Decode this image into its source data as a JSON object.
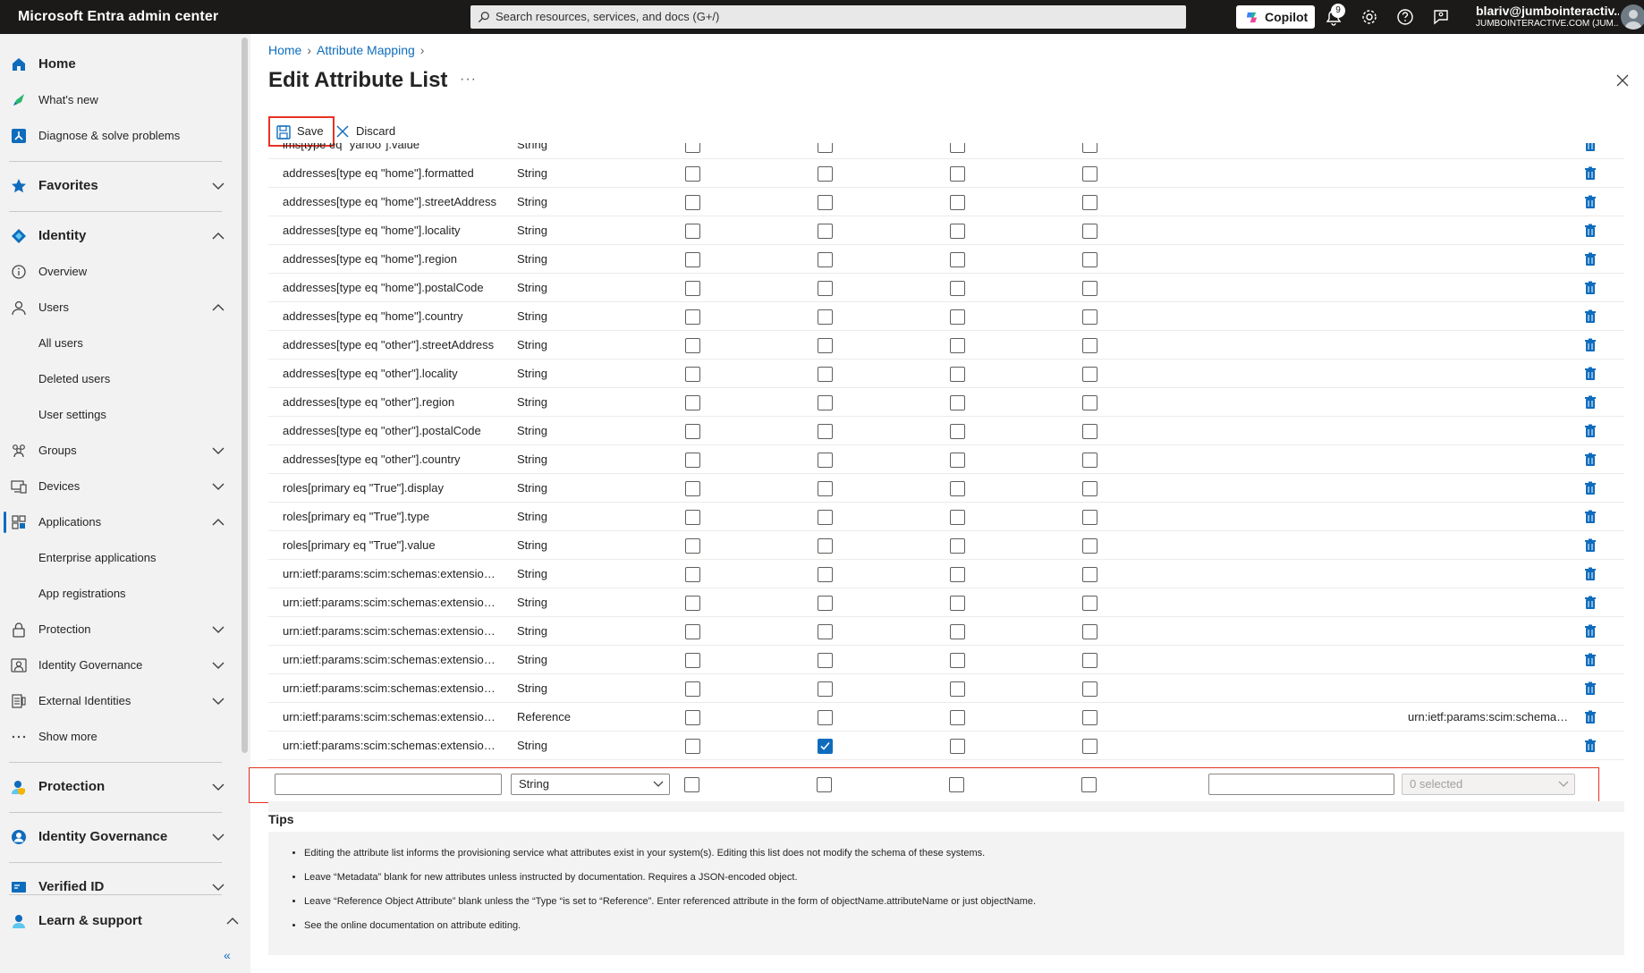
{
  "topbar": {
    "brand": "Microsoft Entra admin center",
    "search_placeholder": "Search resources, services, and docs (G+/)",
    "copilot_label": "Copilot",
    "notification_count": "9",
    "user_name": "blariv@jumbointeractiv...",
    "user_tenant": "JUMBOINTERACTIVE.COM (JUM..."
  },
  "sidebar": {
    "home": "Home",
    "whats_new": "What's new",
    "diagnose": "Diagnose & solve problems",
    "favorites": "Favorites",
    "identity": "Identity",
    "overview": "Overview",
    "users": "Users",
    "all_users": "All users",
    "deleted_users": "Deleted users",
    "user_settings": "User settings",
    "groups": "Groups",
    "devices": "Devices",
    "applications": "Applications",
    "enterprise_apps": "Enterprise applications",
    "app_registrations": "App registrations",
    "protection": "Protection",
    "identity_governance": "Identity Governance",
    "external_identities": "External Identities",
    "show_more": "Show more",
    "protection_section": "Protection",
    "identity_governance_section": "Identity Governance",
    "verified_id": "Verified ID",
    "learn_support": "Learn & support",
    "collapse": "«"
  },
  "breadcrumb": {
    "home": "Home",
    "attribute_mapping": "Attribute Mapping"
  },
  "page": {
    "title": "Edit Attribute List",
    "more": "···"
  },
  "toolbar": {
    "save": "Save",
    "discard": "Discard"
  },
  "rows": [
    {
      "name": "ims[type eq \"yahoo\"].value",
      "type": "String",
      "checks": [
        false,
        false,
        false,
        false
      ],
      "ref": ""
    },
    {
      "name": "addresses[type eq \"home\"].formatted",
      "type": "String",
      "checks": [
        false,
        false,
        false,
        false
      ],
      "ref": ""
    },
    {
      "name": "addresses[type eq \"home\"].streetAddress",
      "type": "String",
      "checks": [
        false,
        false,
        false,
        false
      ],
      "ref": ""
    },
    {
      "name": "addresses[type eq \"home\"].locality",
      "type": "String",
      "checks": [
        false,
        false,
        false,
        false
      ],
      "ref": ""
    },
    {
      "name": "addresses[type eq \"home\"].region",
      "type": "String",
      "checks": [
        false,
        false,
        false,
        false
      ],
      "ref": ""
    },
    {
      "name": "addresses[type eq \"home\"].postalCode",
      "type": "String",
      "checks": [
        false,
        false,
        false,
        false
      ],
      "ref": ""
    },
    {
      "name": "addresses[type eq \"home\"].country",
      "type": "String",
      "checks": [
        false,
        false,
        false,
        false
      ],
      "ref": ""
    },
    {
      "name": "addresses[type eq \"other\"].streetAddress",
      "type": "String",
      "checks": [
        false,
        false,
        false,
        false
      ],
      "ref": ""
    },
    {
      "name": "addresses[type eq \"other\"].locality",
      "type": "String",
      "checks": [
        false,
        false,
        false,
        false
      ],
      "ref": ""
    },
    {
      "name": "addresses[type eq \"other\"].region",
      "type": "String",
      "checks": [
        false,
        false,
        false,
        false
      ],
      "ref": ""
    },
    {
      "name": "addresses[type eq \"other\"].postalCode",
      "type": "String",
      "checks": [
        false,
        false,
        false,
        false
      ],
      "ref": ""
    },
    {
      "name": "addresses[type eq \"other\"].country",
      "type": "String",
      "checks": [
        false,
        false,
        false,
        false
      ],
      "ref": ""
    },
    {
      "name": "roles[primary eq \"True\"].display",
      "type": "String",
      "checks": [
        false,
        false,
        false,
        false
      ],
      "ref": ""
    },
    {
      "name": "roles[primary eq \"True\"].type",
      "type": "String",
      "checks": [
        false,
        false,
        false,
        false
      ],
      "ref": ""
    },
    {
      "name": "roles[primary eq \"True\"].value",
      "type": "String",
      "checks": [
        false,
        false,
        false,
        false
      ],
      "ref": ""
    },
    {
      "name": "urn:ietf:params:scim:schemas:extension:...",
      "type": "String",
      "checks": [
        false,
        false,
        false,
        false
      ],
      "ref": ""
    },
    {
      "name": "urn:ietf:params:scim:schemas:extension:...",
      "type": "String",
      "checks": [
        false,
        false,
        false,
        false
      ],
      "ref": ""
    },
    {
      "name": "urn:ietf:params:scim:schemas:extension:...",
      "type": "String",
      "checks": [
        false,
        false,
        false,
        false
      ],
      "ref": ""
    },
    {
      "name": "urn:ietf:params:scim:schemas:extension:...",
      "type": "String",
      "checks": [
        false,
        false,
        false,
        false
      ],
      "ref": ""
    },
    {
      "name": "urn:ietf:params:scim:schemas:extension:...",
      "type": "String",
      "checks": [
        false,
        false,
        false,
        false
      ],
      "ref": ""
    },
    {
      "name": "urn:ietf:params:scim:schemas:extension:...",
      "type": "Reference",
      "checks": [
        false,
        false,
        false,
        false
      ],
      "ref": "urn:ietf:params:scim:schemas..."
    },
    {
      "name": "urn:ietf:params:scim:schemas:extension:...",
      "type": "String",
      "checks": [
        false,
        true,
        false,
        false
      ],
      "ref": ""
    }
  ],
  "new_row": {
    "name_value": "",
    "type_value": "String",
    "ref_value": "",
    "multi_select": "0 selected"
  },
  "tips": {
    "heading": "Tips",
    "items": [
      "Editing the attribute list informs the provisioning service what attributes exist in your system(s). Editing this list does not modify the schema of these systems.",
      "Leave “Metadata” blank for new attributes unless instructed by documentation. Requires a JSON-encoded object.",
      "Leave “Reference Object Attribute” blank unless the “Type “is set to “Reference”. Enter referenced attribute in the form of objectName.attributeName or just objectName.",
      "See the online documentation on attribute editing."
    ]
  },
  "colors": {
    "accent": "#0f6cbd",
    "highlight": "#e83223",
    "topbar": "#1b1a19"
  }
}
